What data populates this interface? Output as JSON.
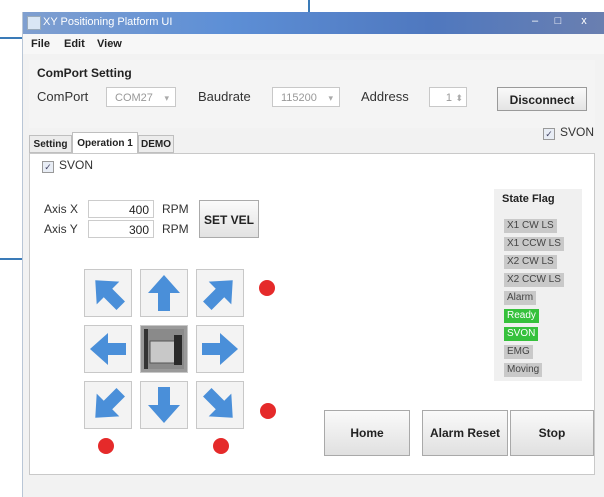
{
  "window": {
    "title": "XY Positioning Platform UI",
    "min_label": "–",
    "max_label": "□",
    "close_label": "x"
  },
  "menu": [
    "File",
    "Edit",
    "View"
  ],
  "comport": {
    "section_title": "ComPort Setting",
    "port_label": "ComPort",
    "port_value": "COM27",
    "baud_label": "Baudrate",
    "baud_value": "115200",
    "address_label": "Address",
    "address_value": "1",
    "disconnect_label": "Disconnect"
  },
  "tabs": [
    "Setting",
    "Operation 1",
    "DEMO"
  ],
  "svon_top": {
    "label": "SVON",
    "checked": true
  },
  "operation": {
    "svon": {
      "label": "SVON",
      "checked": true
    },
    "axis_x": {
      "label": "Axis X",
      "value": "400",
      "unit": "RPM"
    },
    "axis_y": {
      "label": "Axis Y",
      "value": "300",
      "unit": "RPM"
    },
    "set_vel_label": "SET VEL"
  },
  "state_flag": {
    "title": "State Flag",
    "flags": [
      {
        "label": "X1 CW LS",
        "active": false
      },
      {
        "label": "X1 CCW LS",
        "active": false
      },
      {
        "label": "X2 CW LS",
        "active": false
      },
      {
        "label": "X2 CCW LS",
        "active": false
      },
      {
        "label": "Alarm",
        "active": false
      },
      {
        "label": "Ready",
        "active": true
      },
      {
        "label": "SVON",
        "active": true
      },
      {
        "label": "EMG",
        "active": false
      },
      {
        "label": "Moving",
        "active": false
      }
    ]
  },
  "buttons": {
    "home": "Home",
    "alarm_reset": "Alarm Reset",
    "stop": "Stop"
  },
  "colors": {
    "arrow": "#4a8fd9",
    "indicator": "#e52a2a",
    "flag_active": "#36c13c",
    "flag_idle": "#c9c9c9"
  }
}
